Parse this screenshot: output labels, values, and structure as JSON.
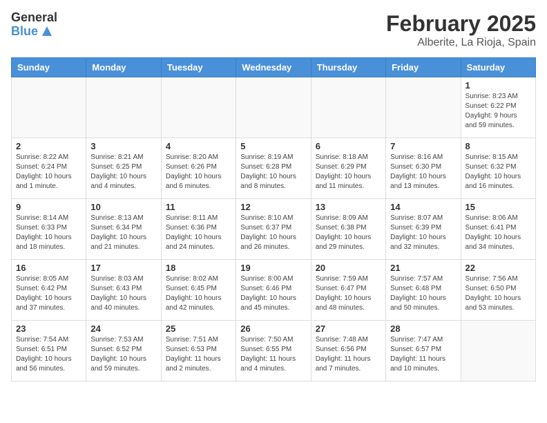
{
  "logo": {
    "general": "General",
    "blue": "Blue"
  },
  "header": {
    "month_year": "February 2025",
    "location": "Alberite, La Rioja, Spain"
  },
  "weekdays": [
    "Sunday",
    "Monday",
    "Tuesday",
    "Wednesday",
    "Thursday",
    "Friday",
    "Saturday"
  ],
  "weeks": [
    [
      {
        "day": "",
        "info": ""
      },
      {
        "day": "",
        "info": ""
      },
      {
        "day": "",
        "info": ""
      },
      {
        "day": "",
        "info": ""
      },
      {
        "day": "",
        "info": ""
      },
      {
        "day": "",
        "info": ""
      },
      {
        "day": "1",
        "info": "Sunrise: 8:23 AM\nSunset: 6:22 PM\nDaylight: 9 hours\nand 59 minutes."
      }
    ],
    [
      {
        "day": "2",
        "info": "Sunrise: 8:22 AM\nSunset: 6:24 PM\nDaylight: 10 hours\nand 1 minute."
      },
      {
        "day": "3",
        "info": "Sunrise: 8:21 AM\nSunset: 6:25 PM\nDaylight: 10 hours\nand 4 minutes."
      },
      {
        "day": "4",
        "info": "Sunrise: 8:20 AM\nSunset: 6:26 PM\nDaylight: 10 hours\nand 6 minutes."
      },
      {
        "day": "5",
        "info": "Sunrise: 8:19 AM\nSunset: 6:28 PM\nDaylight: 10 hours\nand 8 minutes."
      },
      {
        "day": "6",
        "info": "Sunrise: 8:18 AM\nSunset: 6:29 PM\nDaylight: 10 hours\nand 11 minutes."
      },
      {
        "day": "7",
        "info": "Sunrise: 8:16 AM\nSunset: 6:30 PM\nDaylight: 10 hours\nand 13 minutes."
      },
      {
        "day": "8",
        "info": "Sunrise: 8:15 AM\nSunset: 6:32 PM\nDaylight: 10 hours\nand 16 minutes."
      }
    ],
    [
      {
        "day": "9",
        "info": "Sunrise: 8:14 AM\nSunset: 6:33 PM\nDaylight: 10 hours\nand 18 minutes."
      },
      {
        "day": "10",
        "info": "Sunrise: 8:13 AM\nSunset: 6:34 PM\nDaylight: 10 hours\nand 21 minutes."
      },
      {
        "day": "11",
        "info": "Sunrise: 8:11 AM\nSunset: 6:36 PM\nDaylight: 10 hours\nand 24 minutes."
      },
      {
        "day": "12",
        "info": "Sunrise: 8:10 AM\nSunset: 6:37 PM\nDaylight: 10 hours\nand 26 minutes."
      },
      {
        "day": "13",
        "info": "Sunrise: 8:09 AM\nSunset: 6:38 PM\nDaylight: 10 hours\nand 29 minutes."
      },
      {
        "day": "14",
        "info": "Sunrise: 8:07 AM\nSunset: 6:39 PM\nDaylight: 10 hours\nand 32 minutes."
      },
      {
        "day": "15",
        "info": "Sunrise: 8:06 AM\nSunset: 6:41 PM\nDaylight: 10 hours\nand 34 minutes."
      }
    ],
    [
      {
        "day": "16",
        "info": "Sunrise: 8:05 AM\nSunset: 6:42 PM\nDaylight: 10 hours\nand 37 minutes."
      },
      {
        "day": "17",
        "info": "Sunrise: 8:03 AM\nSunset: 6:43 PM\nDaylight: 10 hours\nand 40 minutes."
      },
      {
        "day": "18",
        "info": "Sunrise: 8:02 AM\nSunset: 6:45 PM\nDaylight: 10 hours\nand 42 minutes."
      },
      {
        "day": "19",
        "info": "Sunrise: 8:00 AM\nSunset: 6:46 PM\nDaylight: 10 hours\nand 45 minutes."
      },
      {
        "day": "20",
        "info": "Sunrise: 7:59 AM\nSunset: 6:47 PM\nDaylight: 10 hours\nand 48 minutes."
      },
      {
        "day": "21",
        "info": "Sunrise: 7:57 AM\nSunset: 6:48 PM\nDaylight: 10 hours\nand 50 minutes."
      },
      {
        "day": "22",
        "info": "Sunrise: 7:56 AM\nSunset: 6:50 PM\nDaylight: 10 hours\nand 53 minutes."
      }
    ],
    [
      {
        "day": "23",
        "info": "Sunrise: 7:54 AM\nSunset: 6:51 PM\nDaylight: 10 hours\nand 56 minutes."
      },
      {
        "day": "24",
        "info": "Sunrise: 7:53 AM\nSunset: 6:52 PM\nDaylight: 10 hours\nand 59 minutes."
      },
      {
        "day": "25",
        "info": "Sunrise: 7:51 AM\nSunset: 6:53 PM\nDaylight: 11 hours\nand 2 minutes."
      },
      {
        "day": "26",
        "info": "Sunrise: 7:50 AM\nSunset: 6:55 PM\nDaylight: 11 hours\nand 4 minutes."
      },
      {
        "day": "27",
        "info": "Sunrise: 7:48 AM\nSunset: 6:56 PM\nDaylight: 11 hours\nand 7 minutes."
      },
      {
        "day": "28",
        "info": "Sunrise: 7:47 AM\nSunset: 6:57 PM\nDaylight: 11 hours\nand 10 minutes."
      },
      {
        "day": "",
        "info": ""
      }
    ]
  ]
}
